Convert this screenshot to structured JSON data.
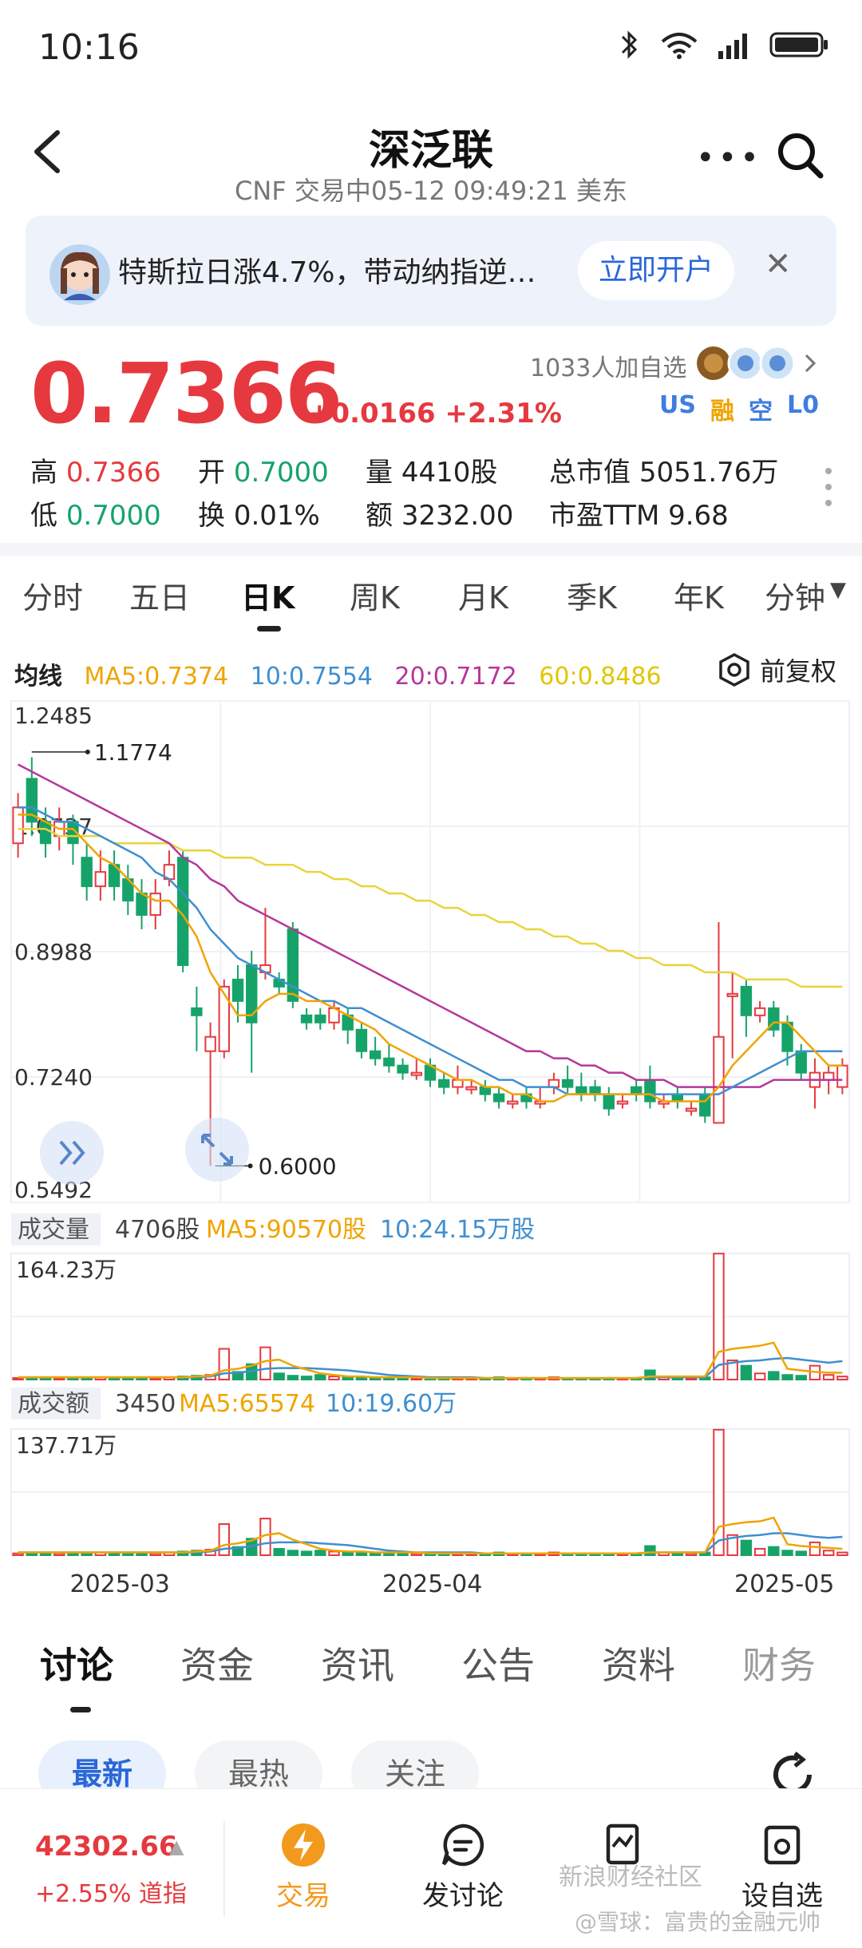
{
  "status_bar": {
    "time": "10:16"
  },
  "nav": {
    "title": "深泛联",
    "subtitle": "CNF 交易中05-12 09:49:21 美东"
  },
  "banner": {
    "text": "特斯拉日涨4.7%，带动纳指逆…",
    "button": "立即开户"
  },
  "quote": {
    "price": "0.7366",
    "change": "+0.0166 +2.31%",
    "watchers": "1033人加自选",
    "badges": [
      {
        "text": "US",
        "color": "#3f7de0"
      },
      {
        "text": "融",
        "color": "#f0a400"
      },
      {
        "text": "空",
        "color": "#3f7de0"
      },
      {
        "text": "L0",
        "color": "#3f7de0"
      }
    ],
    "stats": {
      "high_label": "高",
      "high": "0.7366",
      "open_label": "开",
      "open": "0.7000",
      "vol_label": "量",
      "vol": "4410股",
      "mcap_label": "总市值",
      "mcap": "5051.76万",
      "low_label": "低",
      "low": "0.7000",
      "turnover_label": "换",
      "turnover": "0.01%",
      "amount_label": "额",
      "amount": "3232.00",
      "pe_label": "市盈TTM",
      "pe": "9.68"
    }
  },
  "period_tabs": [
    "分时",
    "五日",
    "日K",
    "周K",
    "月K",
    "季K",
    "年K",
    "分钟"
  ],
  "active_period": "日K",
  "ma_legend": {
    "title": "均线",
    "ma5": "MA5:0.7374",
    "ma10": "10:0.7554",
    "ma20": "20:0.7172",
    "ma60": "60:0.8486",
    "adjust": "前复权"
  },
  "colors": {
    "up": "#e5393f",
    "down": "#16a36a",
    "ma5": "#f0a400",
    "ma10": "#3f8fd0",
    "ma20": "#b5379a",
    "ma60": "#e8d53a"
  },
  "chart_data": {
    "type": "candlestick",
    "y_ticks": [
      "1.2485",
      "1.0737",
      "0.8988",
      "0.7240",
      "0.5492"
    ],
    "ylim": [
      0.5492,
      1.2485
    ],
    "x_ticks": [
      "2025-03",
      "2025-04",
      "2025-05"
    ],
    "annotations": {
      "max": "1.1774",
      "min": "0.6000"
    },
    "candles": [
      {
        "o": 1.05,
        "c": 1.1,
        "h": 1.12,
        "l": 1.03
      },
      {
        "o": 1.14,
        "c": 1.08,
        "h": 1.17,
        "l": 1.06
      },
      {
        "o": 1.08,
        "c": 1.05,
        "h": 1.1,
        "l": 1.03
      },
      {
        "o": 1.06,
        "c": 1.08,
        "h": 1.1,
        "l": 1.04
      },
      {
        "o": 1.08,
        "c": 1.05,
        "h": 1.09,
        "l": 1.02
      },
      {
        "o": 1.03,
        "c": 0.99,
        "h": 1.05,
        "l": 0.97
      },
      {
        "o": 0.99,
        "c": 1.01,
        "h": 1.04,
        "l": 0.97
      },
      {
        "o": 1.02,
        "c": 0.99,
        "h": 1.04,
        "l": 0.97
      },
      {
        "o": 1.0,
        "c": 0.97,
        "h": 1.02,
        "l": 0.95
      },
      {
        "o": 0.98,
        "c": 0.95,
        "h": 1.0,
        "l": 0.93
      },
      {
        "o": 0.95,
        "c": 0.98,
        "h": 1.0,
        "l": 0.93
      },
      {
        "o": 1.0,
        "c": 1.02,
        "h": 1.04,
        "l": 0.99
      },
      {
        "o": 1.03,
        "c": 0.88,
        "h": 1.04,
        "l": 0.87
      },
      {
        "o": 0.82,
        "c": 0.81,
        "h": 0.85,
        "l": 0.76
      },
      {
        "o": 0.76,
        "c": 0.78,
        "h": 0.8,
        "l": 0.6
      },
      {
        "o": 0.76,
        "c": 0.85,
        "h": 0.86,
        "l": 0.75
      },
      {
        "o": 0.86,
        "c": 0.83,
        "h": 0.88,
        "l": 0.8
      },
      {
        "o": 0.88,
        "c": 0.8,
        "h": 0.9,
        "l": 0.73
      },
      {
        "o": 0.87,
        "c": 0.88,
        "h": 0.96,
        "l": 0.86
      },
      {
        "o": 0.86,
        "c": 0.85,
        "h": 0.87,
        "l": 0.84
      },
      {
        "o": 0.93,
        "c": 0.83,
        "h": 0.94,
        "l": 0.82
      },
      {
        "o": 0.81,
        "c": 0.8,
        "h": 0.82,
        "l": 0.79
      },
      {
        "o": 0.81,
        "c": 0.8,
        "h": 0.82,
        "l": 0.79
      },
      {
        "o": 0.8,
        "c": 0.82,
        "h": 0.83,
        "l": 0.79
      },
      {
        "o": 0.81,
        "c": 0.79,
        "h": 0.82,
        "l": 0.77
      },
      {
        "o": 0.79,
        "c": 0.76,
        "h": 0.8,
        "l": 0.75
      },
      {
        "o": 0.76,
        "c": 0.75,
        "h": 0.78,
        "l": 0.74
      },
      {
        "o": 0.75,
        "c": 0.74,
        "h": 0.77,
        "l": 0.73
      },
      {
        "o": 0.74,
        "c": 0.73,
        "h": 0.75,
        "l": 0.72
      },
      {
        "o": 0.73,
        "c": 0.73,
        "h": 0.75,
        "l": 0.72
      },
      {
        "o": 0.74,
        "c": 0.72,
        "h": 0.75,
        "l": 0.71
      },
      {
        "o": 0.72,
        "c": 0.71,
        "h": 0.73,
        "l": 0.7
      },
      {
        "o": 0.71,
        "c": 0.72,
        "h": 0.74,
        "l": 0.7
      },
      {
        "o": 0.71,
        "c": 0.71,
        "h": 0.72,
        "l": 0.7
      },
      {
        "o": 0.71,
        "c": 0.7,
        "h": 0.72,
        "l": 0.69
      },
      {
        "o": 0.7,
        "c": 0.69,
        "h": 0.71,
        "l": 0.68
      },
      {
        "o": 0.69,
        "c": 0.69,
        "h": 0.7,
        "l": 0.68
      },
      {
        "o": 0.7,
        "c": 0.69,
        "h": 0.71,
        "l": 0.68
      },
      {
        "o": 0.69,
        "c": 0.69,
        "h": 0.71,
        "l": 0.68
      },
      {
        "o": 0.71,
        "c": 0.72,
        "h": 0.73,
        "l": 0.7
      },
      {
        "o": 0.72,
        "c": 0.71,
        "h": 0.74,
        "l": 0.7
      },
      {
        "o": 0.71,
        "c": 0.7,
        "h": 0.73,
        "l": 0.69
      },
      {
        "o": 0.71,
        "c": 0.7,
        "h": 0.72,
        "l": 0.69
      },
      {
        "o": 0.7,
        "c": 0.68,
        "h": 0.71,
        "l": 0.67
      },
      {
        "o": 0.69,
        "c": 0.69,
        "h": 0.7,
        "l": 0.68
      },
      {
        "o": 0.71,
        "c": 0.7,
        "h": 0.72,
        "l": 0.69
      },
      {
        "o": 0.72,
        "c": 0.69,
        "h": 0.74,
        "l": 0.68
      },
      {
        "o": 0.69,
        "c": 0.69,
        "h": 0.7,
        "l": 0.68
      },
      {
        "o": 0.7,
        "c": 0.69,
        "h": 0.71,
        "l": 0.68
      },
      {
        "o": 0.68,
        "c": 0.68,
        "h": 0.69,
        "l": 0.67
      },
      {
        "o": 0.7,
        "c": 0.67,
        "h": 0.71,
        "l": 0.66
      },
      {
        "o": 0.66,
        "c": 0.78,
        "h": 0.94,
        "l": 0.66
      },
      {
        "o": 0.84,
        "c": 0.84,
        "h": 0.87,
        "l": 0.75
      },
      {
        "o": 0.85,
        "c": 0.81,
        "h": 0.86,
        "l": 0.78
      },
      {
        "o": 0.81,
        "c": 0.82,
        "h": 0.83,
        "l": 0.8
      },
      {
        "o": 0.82,
        "c": 0.79,
        "h": 0.83,
        "l": 0.78
      },
      {
        "o": 0.8,
        "c": 0.76,
        "h": 0.81,
        "l": 0.74
      },
      {
        "o": 0.76,
        "c": 0.73,
        "h": 0.77,
        "l": 0.72
      },
      {
        "o": 0.71,
        "c": 0.73,
        "h": 0.75,
        "l": 0.68
      },
      {
        "o": 0.72,
        "c": 0.73,
        "h": 0.74,
        "l": 0.7
      },
      {
        "o": 0.71,
        "c": 0.74,
        "h": 0.75,
        "l": 0.7
      }
    ],
    "ma5": [
      1.09,
      1.09,
      1.08,
      1.07,
      1.07,
      1.05,
      1.03,
      1.02,
      1.0,
      0.98,
      0.97,
      0.97,
      0.95,
      0.92,
      0.87,
      0.84,
      0.81,
      0.81,
      0.83,
      0.84,
      0.84,
      0.83,
      0.83,
      0.82,
      0.81,
      0.8,
      0.79,
      0.77,
      0.76,
      0.75,
      0.74,
      0.73,
      0.72,
      0.72,
      0.71,
      0.71,
      0.7,
      0.7,
      0.69,
      0.69,
      0.7,
      0.7,
      0.7,
      0.7,
      0.7,
      0.7,
      0.7,
      0.69,
      0.69,
      0.69,
      0.69,
      0.71,
      0.74,
      0.76,
      0.78,
      0.8,
      0.8,
      0.78,
      0.76,
      0.74,
      0.74
    ],
    "ma10": [
      1.1,
      1.1,
      1.09,
      1.08,
      1.08,
      1.07,
      1.06,
      1.05,
      1.04,
      1.03,
      1.01,
      1.0,
      0.98,
      0.96,
      0.93,
      0.91,
      0.89,
      0.88,
      0.87,
      0.86,
      0.85,
      0.84,
      0.83,
      0.83,
      0.82,
      0.82,
      0.81,
      0.8,
      0.79,
      0.78,
      0.77,
      0.76,
      0.75,
      0.74,
      0.73,
      0.72,
      0.72,
      0.71,
      0.71,
      0.71,
      0.7,
      0.7,
      0.7,
      0.7,
      0.7,
      0.7,
      0.7,
      0.7,
      0.7,
      0.7,
      0.7,
      0.7,
      0.71,
      0.72,
      0.73,
      0.74,
      0.75,
      0.76,
      0.76,
      0.76,
      0.76
    ],
    "ma20": [
      1.16,
      1.15,
      1.14,
      1.13,
      1.12,
      1.11,
      1.1,
      1.09,
      1.08,
      1.07,
      1.06,
      1.05,
      1.03,
      1.02,
      1.0,
      0.99,
      0.97,
      0.96,
      0.95,
      0.94,
      0.93,
      0.92,
      0.91,
      0.9,
      0.89,
      0.88,
      0.87,
      0.86,
      0.85,
      0.84,
      0.83,
      0.82,
      0.81,
      0.8,
      0.79,
      0.78,
      0.77,
      0.76,
      0.76,
      0.75,
      0.75,
      0.74,
      0.74,
      0.73,
      0.73,
      0.72,
      0.72,
      0.72,
      0.71,
      0.71,
      0.71,
      0.71,
      0.71,
      0.71,
      0.71,
      0.72,
      0.72,
      0.72,
      0.72,
      0.72,
      0.72
    ],
    "ma60": [
      1.07,
      1.07,
      1.07,
      1.06,
      1.06,
      1.06,
      1.06,
      1.05,
      1.05,
      1.05,
      1.05,
      1.05,
      1.04,
      1.04,
      1.04,
      1.03,
      1.03,
      1.03,
      1.02,
      1.02,
      1.02,
      1.01,
      1.01,
      1.0,
      1.0,
      0.99,
      0.99,
      0.98,
      0.98,
      0.97,
      0.97,
      0.96,
      0.96,
      0.95,
      0.95,
      0.94,
      0.94,
      0.93,
      0.93,
      0.92,
      0.92,
      0.91,
      0.91,
      0.9,
      0.9,
      0.89,
      0.89,
      0.88,
      0.88,
      0.88,
      0.87,
      0.87,
      0.87,
      0.86,
      0.86,
      0.86,
      0.86,
      0.85,
      0.85,
      0.85,
      0.85
    ],
    "volume": {
      "title": "成交量",
      "latest": "4706股",
      "ma5": "MA5:90570股",
      "ma10": "10:24.15万股",
      "max_label": "164.23万",
      "max": 164.23,
      "values": [
        2,
        3,
        2,
        2,
        2,
        3,
        3,
        2,
        3,
        2,
        2,
        3,
        4,
        5,
        6,
        40,
        10,
        20,
        42,
        8,
        5,
        4,
        6,
        4,
        3,
        3,
        3,
        2,
        2,
        2,
        2,
        2,
        2,
        2,
        2,
        3,
        2,
        2,
        2,
        3,
        2,
        2,
        2,
        2,
        2,
        2,
        12,
        3,
        2,
        2,
        3,
        164,
        25,
        18,
        8,
        10,
        6,
        5,
        18,
        6,
        4
      ],
      "ma5_line": [
        3,
        3,
        3,
        3,
        3,
        3,
        3,
        3,
        3,
        3,
        3,
        3,
        3,
        4,
        5,
        12,
        14,
        18,
        24,
        26,
        18,
        13,
        8,
        6,
        4,
        4,
        3,
        3,
        3,
        3,
        2,
        2,
        2,
        2,
        2,
        2,
        2,
        2,
        2,
        2,
        2,
        2,
        2,
        2,
        2,
        2,
        4,
        4,
        4,
        4,
        4,
        36,
        40,
        42,
        44,
        48,
        14,
        12,
        10,
        9,
        9
      ],
      "ma10_line": [
        3,
        3,
        3,
        3,
        3,
        3,
        3,
        3,
        3,
        3,
        3,
        3,
        3,
        3,
        4,
        8,
        9,
        11,
        14,
        15,
        15,
        15,
        14,
        13,
        12,
        10,
        8,
        6,
        5,
        4,
        3,
        3,
        3,
        3,
        2,
        2,
        2,
        2,
        2,
        2,
        2,
        2,
        2,
        2,
        2,
        2,
        3,
        3,
        3,
        3,
        3,
        19,
        22,
        24,
        25,
        27,
        28,
        26,
        24,
        22,
        24
      ]
    },
    "amount": {
      "title": "成交额",
      "latest": "3450",
      "ma5": "MA5:65574",
      "ma10": "10:19.60万",
      "max_label": "137.71万",
      "max": 137.71,
      "values": [
        2,
        3,
        2,
        2,
        2,
        3,
        3,
        2,
        3,
        2,
        2,
        3,
        4,
        5,
        6,
        34,
        9,
        18,
        40,
        7,
        5,
        4,
        5,
        4,
        3,
        3,
        3,
        2,
        2,
        2,
        2,
        2,
        2,
        2,
        2,
        3,
        2,
        2,
        2,
        3,
        2,
        2,
        2,
        2,
        2,
        2,
        10,
        3,
        2,
        2,
        3,
        137,
        22,
        16,
        7,
        9,
        5,
        4,
        14,
        5,
        3
      ],
      "ma5_line": [
        3,
        3,
        3,
        3,
        3,
        3,
        3,
        3,
        3,
        3,
        3,
        3,
        3,
        4,
        5,
        11,
        13,
        16,
        22,
        24,
        17,
        12,
        7,
        5,
        4,
        4,
        3,
        3,
        3,
        3,
        2,
        2,
        2,
        2,
        2,
        2,
        2,
        2,
        2,
        2,
        2,
        2,
        2,
        2,
        2,
        2,
        3,
        3,
        3,
        3,
        3,
        31,
        34,
        36,
        37,
        41,
        12,
        10,
        9,
        8,
        7
      ],
      "ma10_line": [
        3,
        3,
        3,
        3,
        3,
        3,
        3,
        3,
        3,
        3,
        3,
        3,
        3,
        3,
        4,
        7,
        8,
        10,
        13,
        14,
        14,
        14,
        13,
        12,
        11,
        9,
        7,
        5,
        4,
        3,
        3,
        3,
        3,
        3,
        2,
        2,
        2,
        2,
        2,
        2,
        2,
        2,
        2,
        2,
        2,
        2,
        3,
        3,
        3,
        3,
        3,
        16,
        19,
        21,
        22,
        24,
        24,
        22,
        20,
        19,
        20
      ]
    }
  },
  "content_tabs": [
    "讨论",
    "资金",
    "资讯",
    "公告",
    "资料",
    "财务"
  ],
  "active_content_tab": "讨论",
  "filter_chips": [
    "最新",
    "最热",
    "关注"
  ],
  "bottom_bar": {
    "index_value": "42302.66",
    "index_change": "+2.55% 道指",
    "items": [
      "交易",
      "发讨论",
      "",
      "设自选"
    ]
  },
  "watermark": {
    "line1": "新浪财经社区",
    "line2": "@雪球：富贵的金融元帅"
  }
}
